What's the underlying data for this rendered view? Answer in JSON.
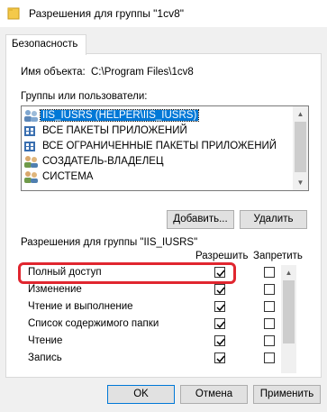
{
  "window": {
    "title": "Разрешения для группы \"1cv8\""
  },
  "tabs": [
    {
      "label": "Безопасность"
    }
  ],
  "object": {
    "label": "Имя объекта:",
    "value": "C:\\Program Files\\1cv8"
  },
  "groups": {
    "label": "Группы или пользователи:",
    "items": [
      {
        "label": "IIS_IUSRS (HELPER\\IIS_IUSRS)",
        "icon": "users-icon",
        "selected": true
      },
      {
        "label": "ВСЕ ПАКЕТЫ ПРИЛОЖЕНИЙ",
        "icon": "package-icon",
        "selected": false
      },
      {
        "label": "ВСЕ ОГРАНИЧЕННЫЕ ПАКЕТЫ ПРИЛОЖЕНИЙ",
        "icon": "package-icon",
        "selected": false
      },
      {
        "label": "СОЗДАТЕЛЬ-ВЛАДЕЛЕЦ",
        "icon": "users-icon",
        "selected": false
      },
      {
        "label": "СИСТЕМА",
        "icon": "users-icon",
        "selected": false
      }
    ],
    "add_button": "Добавить...",
    "remove_button": "Удалить"
  },
  "permissions": {
    "label": "Разрешения для группы \"IIS_IUSRS\"",
    "col_allow": "Разрешить",
    "col_deny": "Запретить",
    "rows": [
      {
        "name": "Полный доступ",
        "allow": true,
        "deny": false
      },
      {
        "name": "Изменение",
        "allow": true,
        "deny": false
      },
      {
        "name": "Чтение и выполнение",
        "allow": true,
        "deny": false
      },
      {
        "name": "Список содержимого папки",
        "allow": true,
        "deny": false
      },
      {
        "name": "Чтение",
        "allow": true,
        "deny": false
      },
      {
        "name": "Запись",
        "allow": true,
        "deny": false
      }
    ]
  },
  "footer": {
    "ok": "OK",
    "cancel": "Отмена",
    "apply": "Применить"
  },
  "colors": {
    "selection": "#0078d7",
    "highlight_annotation": "#e0262f"
  }
}
